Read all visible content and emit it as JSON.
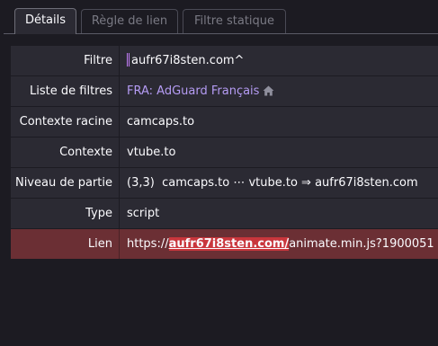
{
  "tabs": [
    {
      "label": "Détails",
      "active": true
    },
    {
      "label": "Règle de lien",
      "active": false
    },
    {
      "label": "Filtre statique",
      "active": false
    }
  ],
  "rows": {
    "filter": {
      "label": "Filtre",
      "value": "aufr67i8sten.com^"
    },
    "filter_list": {
      "label": "Liste de filtres",
      "value": "FRA: AdGuard Français"
    },
    "root_context": {
      "label": "Contexte racine",
      "value": "camcaps.to"
    },
    "context": {
      "label": "Contexte",
      "value": "vtube.to"
    },
    "party_level": {
      "label": "Niveau de partie",
      "value": "(3,3)  camcaps.to ⋯ vtube.to ⇒ aufr67i8sten.com"
    },
    "type": {
      "label": "Type",
      "value": "script"
    },
    "link": {
      "label": "Lien",
      "prefix": "https://",
      "highlight": "aufr67i8sten.com/",
      "suffix": "animate.min.js?1900051"
    }
  },
  "icons": {
    "filter_list_home": "home-icon"
  },
  "colors": {
    "background": "#1c1b22",
    "row_background": "#2b2a33",
    "link_row_background": "#6b2f34",
    "highlight": "#c9363c",
    "list_link": "#b59cf4",
    "filter_marker": "#c17cf5"
  }
}
